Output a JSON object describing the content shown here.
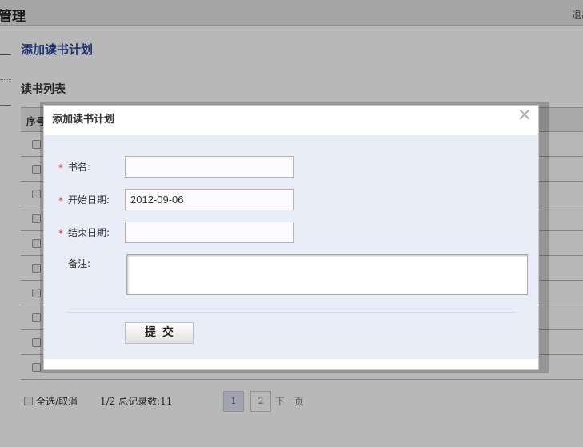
{
  "app": {
    "title": "管理",
    "logout_label": "退出"
  },
  "page": {
    "heading": "添加读书计划",
    "list_heading": "读书列表"
  },
  "table": {
    "first_column_header": "序号",
    "row_count_visible": 10
  },
  "footer": {
    "select_all_label": "全选/取消",
    "summary": "1/2 总记录数:11",
    "pages": [
      "1",
      "2"
    ],
    "current_page": "1",
    "next_label": "下一页"
  },
  "dialog": {
    "title": "添加读书计划",
    "close_glyph": "×",
    "required_marker": "*",
    "fields": {
      "book_name": {
        "label": "书名:",
        "value": ""
      },
      "start_date": {
        "label": "开始日期:",
        "value": "2012-09-06"
      },
      "end_date": {
        "label": "结束日期:",
        "value": ""
      },
      "notes": {
        "label": "备注:",
        "value": ""
      }
    },
    "submit_label": "提交"
  }
}
